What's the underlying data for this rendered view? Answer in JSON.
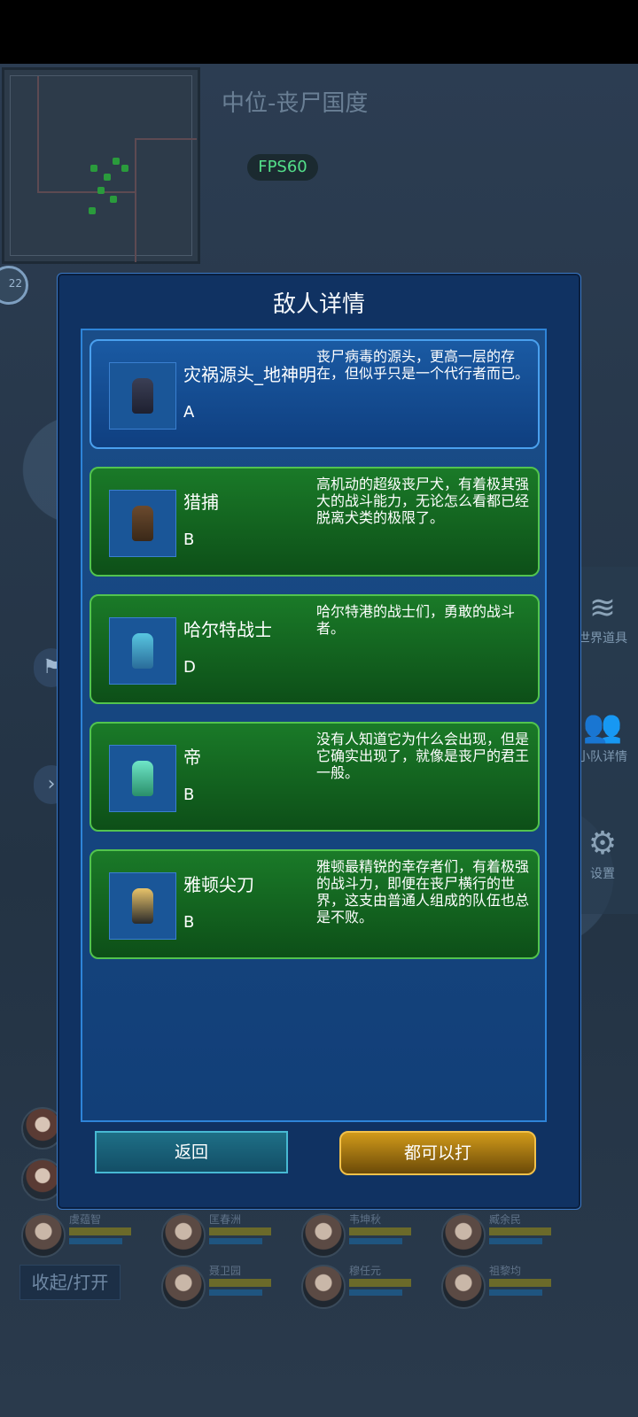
{
  "zone": {
    "title": "中位-丧尸国度",
    "fps": "FPS60"
  },
  "round_badge": "22",
  "dialog": {
    "title": "敌人详情",
    "enemies": [
      {
        "name": "灾祸源头_地神明",
        "rank": "A",
        "desc": "丧尸病毒的源头，更高一层的存在，但似乎只是一个代行者而已。",
        "style": "boss"
      },
      {
        "name": "猎捕",
        "rank": "B",
        "desc": "高机动的超级丧尸犬，有着极其强大的战斗能力，无论怎么看都已经脱离犬类的极限了。",
        "style": "normal"
      },
      {
        "name": "哈尔特战士",
        "rank": "D",
        "desc": "哈尔特港的战士们，勇敢的战斗者。",
        "style": "normal"
      },
      {
        "name": "帝",
        "rank": "B",
        "desc": "没有人知道它为什么会出现，但是它确实出现了，就像是丧尸的君王一般。",
        "style": "normal"
      },
      {
        "name": "雅顿尖刀",
        "rank": "B",
        "desc": "雅顿最精锐的幸存者们，有着极强的战斗力，即便在丧尸横行的世界，这支由普通人组成的队伍也总是不败。",
        "style": "normal"
      }
    ],
    "back_label": "返回",
    "fight_label": "都可以打"
  },
  "right_menu": [
    {
      "label": "世界道具",
      "icon": "layers-icon"
    },
    {
      "label": "小队详情",
      "icon": "team-icon"
    },
    {
      "label": "设置",
      "icon": "gear-icon"
    }
  ],
  "team": [
    {
      "name": "虞蕴智"
    },
    {
      "name": "匡春洲"
    },
    {
      "name": "韦坤秋"
    },
    {
      "name": "臧余民"
    },
    {
      "name": "聂卫园"
    },
    {
      "name": "穆任元"
    },
    {
      "name": "祖黎均"
    }
  ],
  "toggle_label": "收起/打开",
  "colors": {
    "boss_card": "#1a5aa3",
    "normal_card": "#1a7a28",
    "fight_button": "#d19a1a",
    "back_button": "#1e6f86"
  }
}
